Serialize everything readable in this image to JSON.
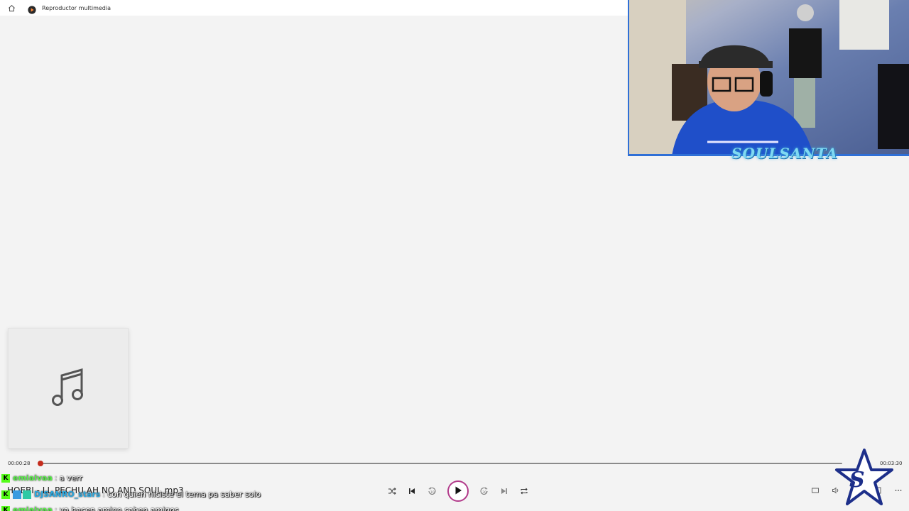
{
  "app": {
    "title": "Reproductor multimedia"
  },
  "player": {
    "song_title": "HOEBI - LL PECHU AH NO AND SOUL.mp3",
    "current_time": "00:00:28",
    "total_time": "00:03:30",
    "progress_fraction": 0.0,
    "accent_color": "#c42b1c"
  },
  "overlay": {
    "streamer_name": "SOULSANTA",
    "chat": [
      {
        "user": "emialvaa",
        "separator": ":",
        "message": "a verr"
      },
      {
        "user": "DJSANRO_stars",
        "separator": ":",
        "message": "con quien hiciste el tema pa saber solo"
      },
      {
        "user": "emialvaa",
        "separator": ":",
        "message": "ya hacen amigo saben amigos"
      }
    ]
  },
  "icons": {
    "home": "home-icon",
    "app": "media-player-icon",
    "album_placeholder": "music-note-icon",
    "shuffle": "shuffle-icon",
    "previous": "previous-icon",
    "rewind": "rewind-10-icon",
    "play": "play-icon",
    "forward": "forward-30-icon",
    "next": "next-icon",
    "repeat": "repeat-icon",
    "miniplayer": "miniplayer-icon",
    "volume": "volume-icon",
    "cast": "cast-icon",
    "more": "more-icon"
  }
}
